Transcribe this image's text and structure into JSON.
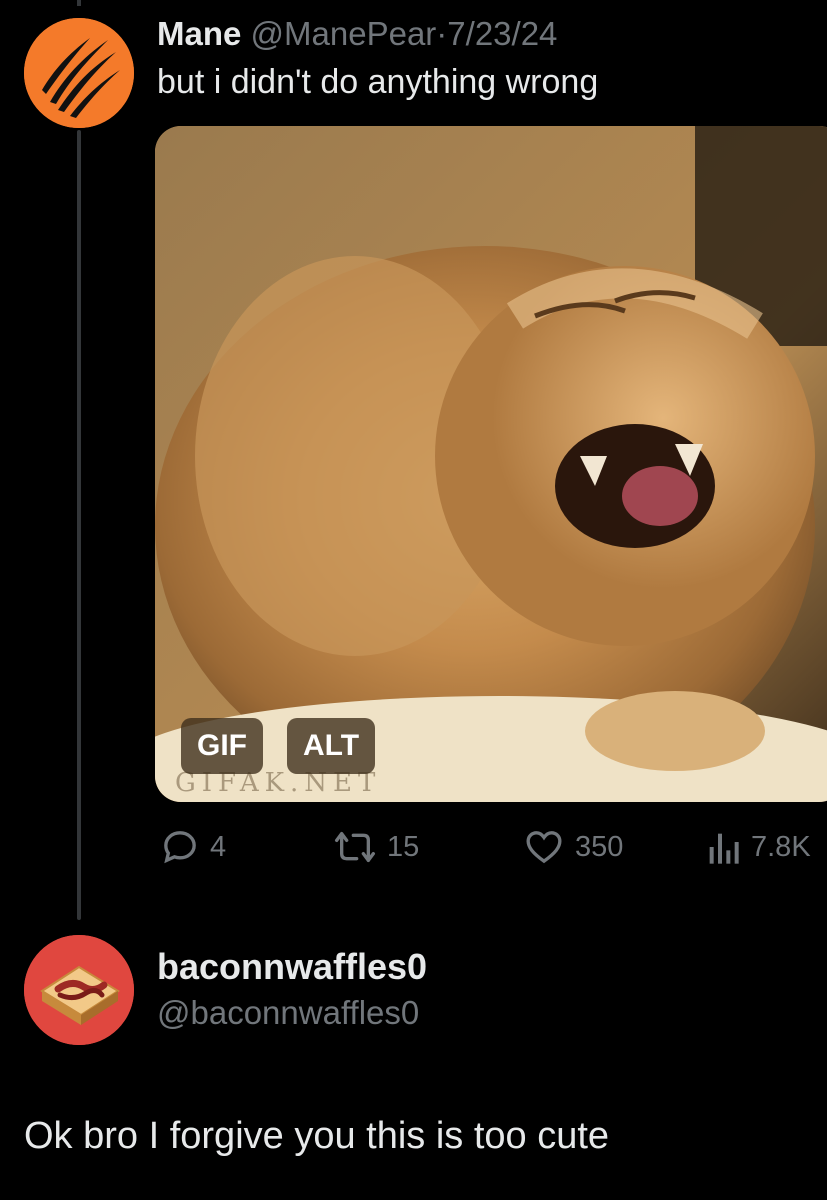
{
  "tweet": {
    "display_name": "Mane",
    "handle": "@ManePear",
    "separator": "·",
    "date": "7/23/24",
    "text": "but i didn't do anything wrong",
    "avatar_icon": "claw-marks-icon",
    "avatar_color": "#f47a2a",
    "media": {
      "kind": "gif",
      "subject": "fluffy orange lion-like cat yawning",
      "watermark": "GIFAK.NET",
      "gif_badge": "GIF",
      "alt_badge": "ALT"
    },
    "stats": {
      "replies": "4",
      "retweets": "15",
      "likes": "350",
      "views": "7.8K"
    }
  },
  "reply": {
    "display_name": "baconnwaffles0",
    "handle": "@baconnwaffles0",
    "text": "Ok bro I forgive you this is too cute",
    "avatar_icon": "bacon-waffle-icon",
    "avatar_color": "#e0473f"
  },
  "colors": {
    "background": "#000000",
    "text_primary": "#e7e9ea",
    "text_secondary": "#71767b",
    "thread_line": "#333639"
  }
}
